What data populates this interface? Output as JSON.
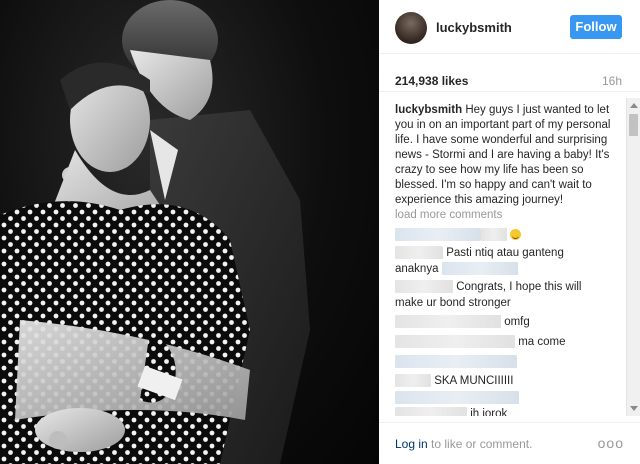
{
  "post": {
    "username": "luckybsmith",
    "follow_label": "Follow",
    "likes": "214,938 likes",
    "time": "16h",
    "caption_user": "luckybsmith",
    "caption_text": "Hey guys I just wanted to let you in on an important part of my personal life. I have some wonderful and surprising news - Stormi and I are having a baby! It's crazy to see how my life has been so blessed. I'm so happy and can't wait to experience this amazing journey!",
    "load_more": "load more comments"
  },
  "comments": [
    {
      "text": ""
    },
    {
      "text": "Pasti ntiq atau ganteng"
    },
    {
      "text": "anaknya"
    },
    {
      "text": "Congrats, I hope this will"
    },
    {
      "text": "make ur bond stronger"
    },
    {
      "text": "omfg"
    },
    {
      "text": "ma come"
    },
    {
      "text": ""
    },
    {
      "text": "SKA MUNCIIIIII"
    },
    {
      "text": ""
    },
    {
      "text": "ih jorok"
    }
  ],
  "footer": {
    "login_label": "Log in",
    "login_suffix": " to like or comment.",
    "more_label": "ooo"
  },
  "icons": {
    "more": "more-options-icon",
    "emoji": "grinning-face-emoji"
  },
  "colors": {
    "follow_button": "#3897f0",
    "link": "#003569",
    "muted": "#999999"
  }
}
